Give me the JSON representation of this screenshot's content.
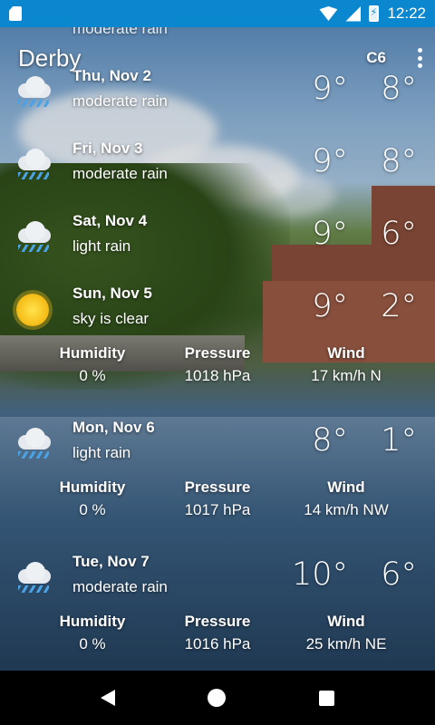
{
  "status_bar": {
    "time": "12:22"
  },
  "app_bar": {
    "city": "Derby",
    "unit": "C6"
  },
  "forecast": [
    {
      "day": "",
      "desc": "moderate rain",
      "tmax": "",
      "tmin": "",
      "icon": "rain-cloud-icon"
    },
    {
      "day": "Thu, Nov 2",
      "desc": "moderate rain",
      "tmax": "9°",
      "tmin": "8°",
      "icon": "rain-cloud-icon"
    },
    {
      "day": "Fri, Nov 3",
      "desc": "moderate rain",
      "tmax": "9°",
      "tmin": "8°",
      "icon": "rain-cloud-icon"
    },
    {
      "day": "Sat, Nov 4",
      "desc": "light rain",
      "tmax": "9°",
      "tmin": "6°",
      "icon": "rain-cloud-icon"
    },
    {
      "day": "Sun, Nov 5",
      "desc": "sky is clear",
      "tmax": "9°",
      "tmin": "2°",
      "icon": "sun-icon",
      "humidity_label": "Humidity",
      "humidity": "0 %",
      "pressure_label": "Pressure",
      "pressure": "1018 hPa",
      "wind_label": "Wind",
      "wind": "17 km/h N"
    },
    {
      "day": "Mon, Nov 6",
      "desc": "light rain",
      "tmax": "8°",
      "tmin": "1°",
      "icon": "rain-cloud-icon",
      "humidity_label": "Humidity",
      "humidity": "0 %",
      "pressure_label": "Pressure",
      "pressure": "1017 hPa",
      "wind_label": "Wind",
      "wind": "14 km/h NW"
    },
    {
      "day": "Tue, Nov 7",
      "desc": "moderate rain",
      "tmax": "10°",
      "tmin": "6°",
      "icon": "rain-cloud-icon",
      "humidity_label": "Humidity",
      "humidity": "0 %",
      "pressure_label": "Pressure",
      "pressure": "1016 hPa",
      "wind_label": "Wind",
      "wind": "25 km/h NE"
    }
  ]
}
